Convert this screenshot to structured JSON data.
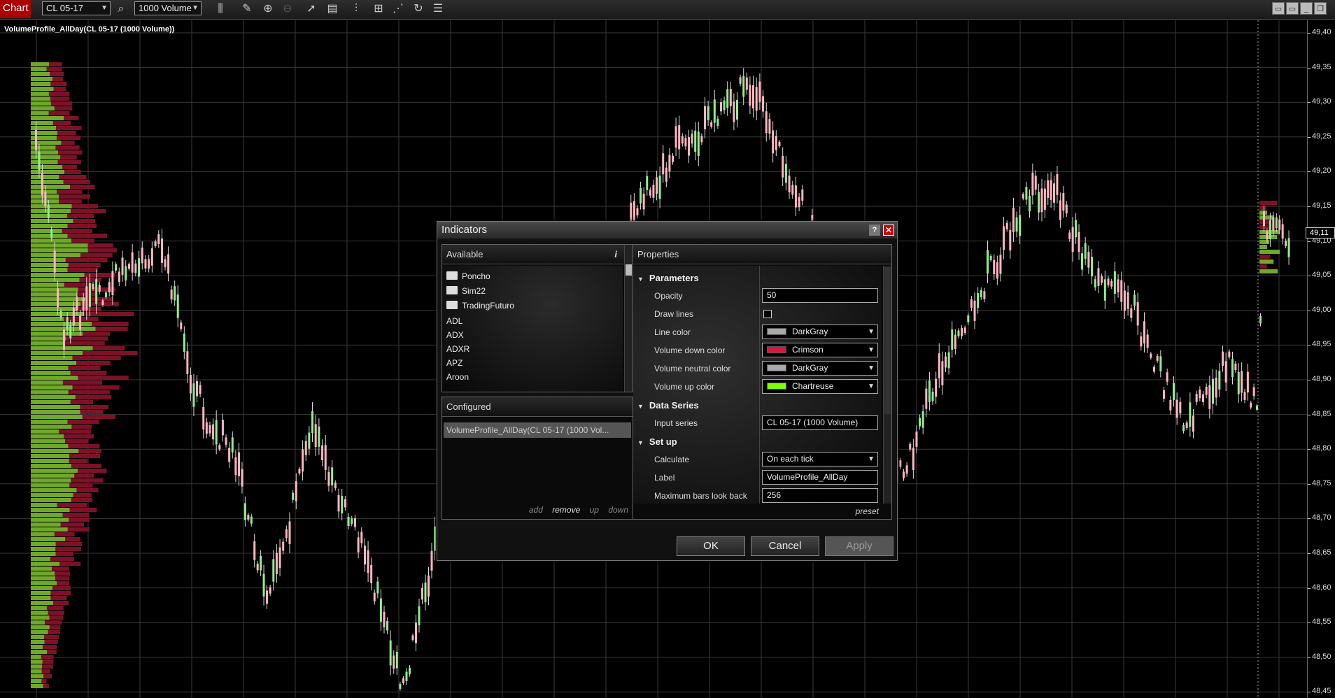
{
  "toolbar": {
    "title": "Chart",
    "instrument": "CL 05-17",
    "period": "1000 Volume",
    "icons": [
      "search-icon",
      "bar-type-icon",
      "pencil-icon",
      "zoom-in-icon",
      "zoom-out-icon",
      "pointer-icon",
      "properties-icon",
      "indicators-icon",
      "strategies-icon",
      "chart-trader-icon",
      "refresh-icon",
      "menu-icon"
    ]
  },
  "chart": {
    "title": "VolumeProfile_AllDay(CL 05-17 (1000 Volume))",
    "price_ticks": [
      "49,40",
      "49,35",
      "49,30",
      "49,25",
      "49,20",
      "49,15",
      "49,10",
      "49,05",
      "49,00",
      "48,95",
      "48,90",
      "48,85",
      "48,80",
      "48,75",
      "48,70",
      "48,65",
      "48,60",
      "48,55",
      "48,50",
      "48,45"
    ],
    "last_price": "49,11",
    "colors": {
      "up": "#90ee90",
      "down": "#ffb6c1",
      "vol_up": "#6fa82a",
      "vol_down": "#7d1127",
      "grid": "#3a3a3a"
    }
  },
  "dialog": {
    "title": "Indicators",
    "help": "?",
    "close": "✕",
    "available": {
      "header": "Available",
      "info": "i",
      "folders": [
        "Poncho",
        "Sim22",
        "TradingFuturo"
      ],
      "items": [
        "ADL",
        "ADX",
        "ADXR",
        "APZ",
        "Aroon"
      ]
    },
    "configured": {
      "header": "Configured",
      "item": "VolumeProfile_AllDay(CL 05-17 (1000 Vol...",
      "actions": {
        "add": "add",
        "remove": "remove",
        "up": "up",
        "down": "down"
      }
    },
    "properties": {
      "header": "Properties",
      "sections": {
        "parameters": "Parameters",
        "data_series": "Data Series",
        "setup": "Set up"
      },
      "opacity": {
        "label": "Opacity",
        "value": "50"
      },
      "draw_lines": {
        "label": "Draw lines"
      },
      "line_color": {
        "label": "Line color",
        "value": "DarkGray",
        "swatch": "#a9a9a9"
      },
      "volume_down_color": {
        "label": "Volume down color",
        "value": "Crimson",
        "swatch": "#dc143c"
      },
      "volume_neutral_color": {
        "label": "Volume neutral color",
        "value": "DarkGray",
        "swatch": "#a9a9a9"
      },
      "volume_up_color": {
        "label": "Volume up color",
        "value": "Chartreuse",
        "swatch": "#7fff00"
      },
      "input_series": {
        "label": "Input series",
        "value": "CL 05-17 (1000 Volume)"
      },
      "calculate": {
        "label": "Calculate",
        "value": "On each tick"
      },
      "label_field": {
        "label": "Label",
        "value": "VolumeProfile_AllDay"
      },
      "max_bars": {
        "label": "Maximum bars look back",
        "value": "256"
      },
      "preset": "preset"
    },
    "buttons": {
      "ok": "OK",
      "cancel": "Cancel",
      "apply": "Apply"
    }
  }
}
